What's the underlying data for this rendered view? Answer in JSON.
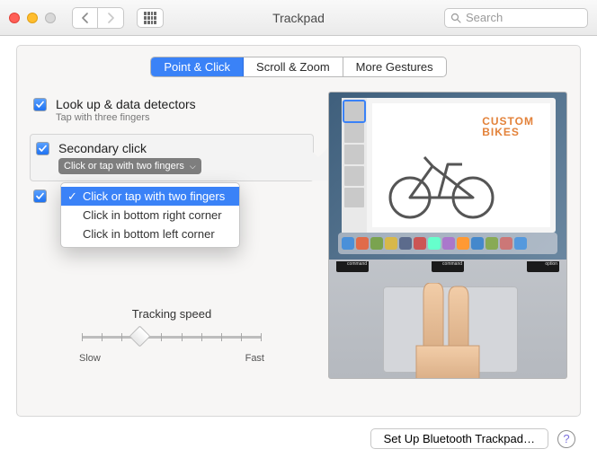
{
  "window": {
    "title": "Trackpad"
  },
  "search": {
    "placeholder": "Search"
  },
  "tabs": {
    "point_click": "Point & Click",
    "scroll_zoom": "Scroll & Zoom",
    "more": "More Gestures"
  },
  "options": {
    "lookup": {
      "title": "Look up & data detectors",
      "subtitle": "Tap with three fingers"
    },
    "secondary": {
      "title": "Secondary click",
      "selected": "Click or tap with two fingers"
    },
    "third_visible_checkbox": true
  },
  "menu": {
    "items": [
      "Click or tap with two fingers",
      "Click in bottom right corner",
      "Click in bottom left corner"
    ],
    "selected_index": 0
  },
  "tracking": {
    "label": "Tracking speed",
    "slow": "Slow",
    "fast": "Fast"
  },
  "preview": {
    "headline1": "CUSTOM",
    "headline2": "BIKES",
    "key_labels": [
      "command",
      "command",
      "option"
    ]
  },
  "footer": {
    "bluetooth": "Set Up Bluetooth Trackpad…"
  }
}
